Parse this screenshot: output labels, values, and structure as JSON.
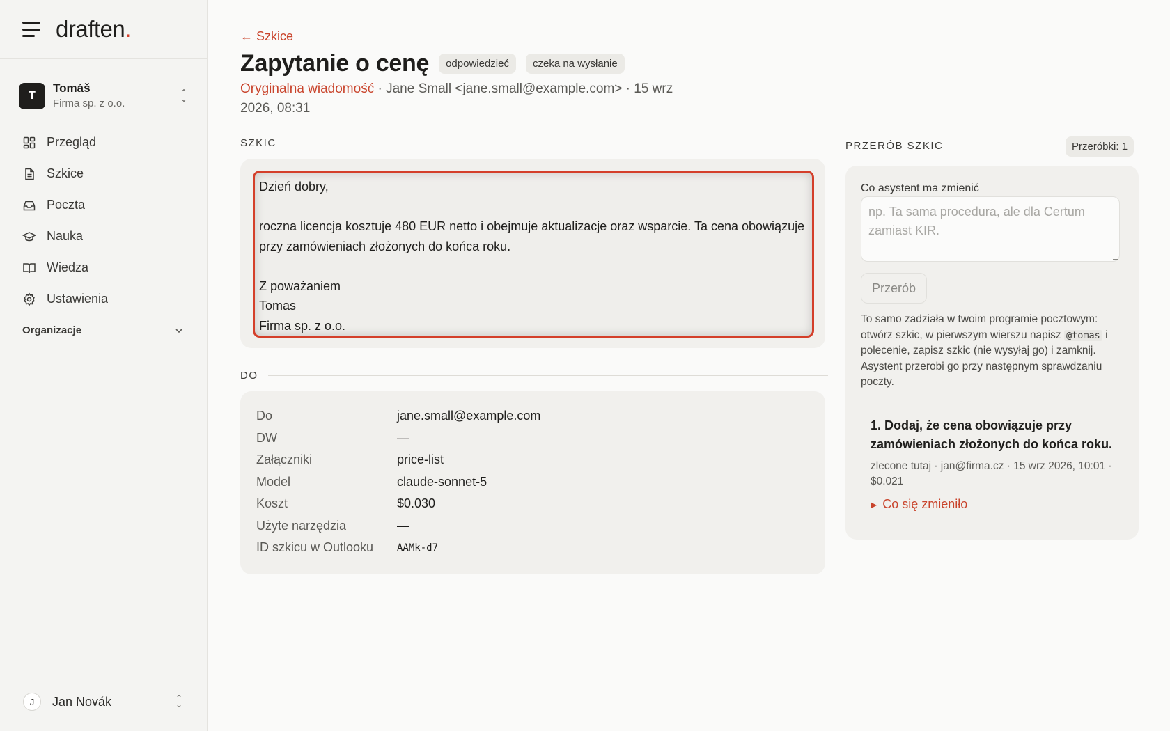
{
  "brand": {
    "name": "draften",
    "dot": "."
  },
  "account": {
    "initial": "T",
    "name": "Tomáš",
    "org": "Firma sp. z o.o."
  },
  "sidebar": {
    "items": [
      {
        "label": "Przegląd",
        "icon": "grid-icon"
      },
      {
        "label": "Szkice",
        "icon": "document-icon"
      },
      {
        "label": "Poczta",
        "icon": "inbox-icon"
      },
      {
        "label": "Nauka",
        "icon": "graduation-cap-icon"
      },
      {
        "label": "Wiedza",
        "icon": "book-icon"
      },
      {
        "label": "Ustawienia",
        "icon": "gear-icon"
      }
    ],
    "org_section": "Organizacje"
  },
  "user": {
    "initial": "J",
    "name": "Jan Novák"
  },
  "header": {
    "back": "← Szkice",
    "title": "Zapytanie o cenę",
    "badges": [
      "odpowiedzieć",
      "czeka na wysłanie"
    ],
    "original_link": "Oryginalna wiadomość",
    "meta_rest": " · Jane Small <jane.small@example.com> · 15 wrz 2026, 08:31"
  },
  "draft": {
    "section": "SZKIC",
    "body": "Dzień dobry,\n\nroczna licencja kosztuje 480 EUR netto i obejmuje aktualizacje oraz wsparcie. Ta cena obowiązuje przy zamówieniach złożonych do końca roku.\n\nZ poważaniem\nTomas\nFirma sp. z o.o."
  },
  "details": {
    "section": "DO",
    "rows": [
      {
        "k": "Do",
        "v": "jane.small@example.com"
      },
      {
        "k": "DW",
        "v": "—"
      },
      {
        "k": "Załączniki",
        "v": "price-list"
      },
      {
        "k": "Model",
        "v": "claude-sonnet-5"
      },
      {
        "k": "Koszt",
        "v": "$0.030"
      },
      {
        "k": "Użyte narzędzia",
        "v": "—"
      },
      {
        "k": "ID szkicu w Outlooku",
        "v": "AAMk-d7"
      }
    ]
  },
  "rework": {
    "section": "PRZERÓB SZKIC",
    "count": "Przeróbki: 1",
    "label": "Co asystent ma zmienić",
    "placeholder": "np. Ta sama procedura, ale dla Certum zamiast KIR.",
    "button": "Przerób",
    "help_before": "To samo zadziała w twoim programie pocztowym: otwórz szkic, w pierwszym wierszu napisz ",
    "help_code": "@tomas",
    "help_after": " i polecenie, zapisz szkic (nie wysyłaj go) i zamknij. Asystent przerobi go przy następnym sprawdzaniu poczty.",
    "entry": {
      "title": "1. Dodaj, że cena obowiązuje przy zamówieniach złożonych do końca roku.",
      "meta": "zlecone tutaj · jan@firma.cz · 15 wrz 2026, 10:01 · $0.021",
      "toggle": "Co się zmieniło"
    }
  },
  "colors": {
    "accent": "#d43f2a",
    "link": "#c9442c"
  }
}
